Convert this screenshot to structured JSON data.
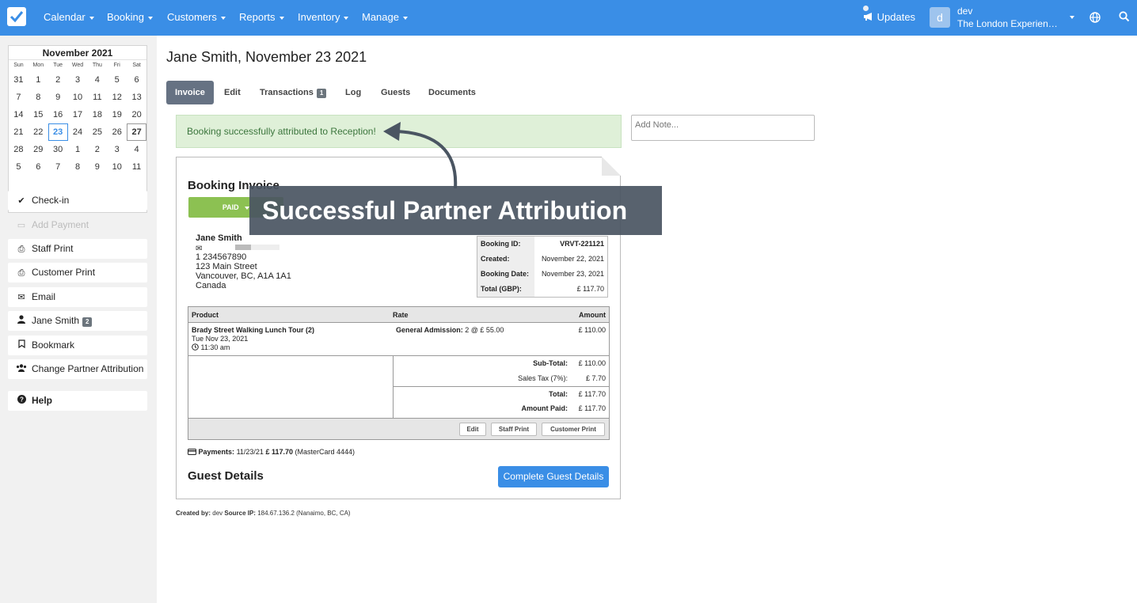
{
  "nav": {
    "items": [
      {
        "label": "Calendar"
      },
      {
        "label": "Booking"
      },
      {
        "label": "Customers"
      },
      {
        "label": "Reports"
      },
      {
        "label": "Inventory"
      },
      {
        "label": "Manage"
      }
    ],
    "updates_label": "Updates",
    "avatar_letter": "d",
    "user_name": "dev",
    "user_org": "The London Experience Tours"
  },
  "calendar": {
    "title": "November 2021",
    "dow": [
      "Sun",
      "Mon",
      "Tue",
      "Wed",
      "Thu",
      "Fri",
      "Sat"
    ],
    "weeks": [
      [
        "31",
        "1",
        "2",
        "3",
        "4",
        "5",
        "6"
      ],
      [
        "7",
        "8",
        "9",
        "10",
        "11",
        "12",
        "13"
      ],
      [
        "14",
        "15",
        "16",
        "17",
        "18",
        "19",
        "20"
      ],
      [
        "21",
        "22",
        "23",
        "24",
        "25",
        "26",
        "27"
      ],
      [
        "28",
        "29",
        "30",
        "1",
        "2",
        "3",
        "4"
      ],
      [
        "5",
        "6",
        "7",
        "8",
        "9",
        "10",
        "11"
      ]
    ]
  },
  "sidebar": {
    "checkin": "Check-in",
    "add_payment": "Add Payment",
    "staff_print": "Staff Print",
    "customer_print": "Customer Print",
    "email": "Email",
    "customer_name": "Jane Smith",
    "customer_badge": "2",
    "bookmark": "Bookmark",
    "change_partner": "Change Partner Attribution",
    "help": "Help"
  },
  "page": {
    "title": "Jane Smith, November 23 2021"
  },
  "tabs": [
    {
      "label": "Invoice",
      "active": true
    },
    {
      "label": "Edit"
    },
    {
      "label": "Transactions",
      "badge": "1"
    },
    {
      "label": "Log"
    },
    {
      "label": "Guests"
    },
    {
      "label": "Documents"
    }
  ],
  "alert": {
    "message": "Booking successfully attributed to Reception!"
  },
  "note": {
    "placeholder": "Add Note..."
  },
  "invoice": {
    "title": "Booking Invoice",
    "status_label": "PAID",
    "customer": {
      "name": "Jane Smith",
      "phone": "1 234567890",
      "street": "123 Main Street",
      "city": "Vancouver, BC, A1A 1A1",
      "country": "Canada"
    },
    "meta": [
      {
        "key": "Booking ID:",
        "value": "VRVT-221121"
      },
      {
        "key": "Created:",
        "value": "November 22, 2021"
      },
      {
        "key": "Booking Date:",
        "value": "November 23, 2021"
      },
      {
        "key": "Total (GBP):",
        "value": "£ 117.70"
      }
    ],
    "columns": {
      "product": "Product",
      "rate": "Rate",
      "amount": "Amount"
    },
    "line_item": {
      "product": "Brady Street Walking Lunch Tour (2)",
      "date": "Tue Nov 23, 2021",
      "time": "11:30 am",
      "rate_label": "General Admission:",
      "rate_detail": "2 @ £ 55.00",
      "amount": "£ 110.00"
    },
    "totals": {
      "subtotal_label": "Sub-Total:",
      "subtotal": "£ 110.00",
      "tax_label": "Sales Tax (7%):",
      "tax": "£ 7.70",
      "total_label": "Total:",
      "total": "£ 117.70",
      "paid_label": "Amount Paid:",
      "paid": "£ 117.70"
    },
    "footer_buttons": {
      "edit": "Edit",
      "staff_print": "Staff Print",
      "customer_print": "Customer Print"
    },
    "payments": {
      "label": "Payments:",
      "date": "11/23/21",
      "amount": "£ 117.70",
      "method": "(MasterCard 4444)"
    },
    "guest_details_title": "Guest Details",
    "guest_details_button": "Complete Guest Details"
  },
  "created": {
    "by_label": "Created by:",
    "by": "dev",
    "ip_label": "Source IP:",
    "ip": "184.67.136.2 (Nanaimo, BC, CA)"
  },
  "callout": {
    "text": "Successful Partner Attribution"
  },
  "colors": {
    "brand": "#3a8ee6",
    "paid": "#8cc152",
    "alert_bg": "#dff0d8",
    "callout_bg": "#4a5562"
  }
}
